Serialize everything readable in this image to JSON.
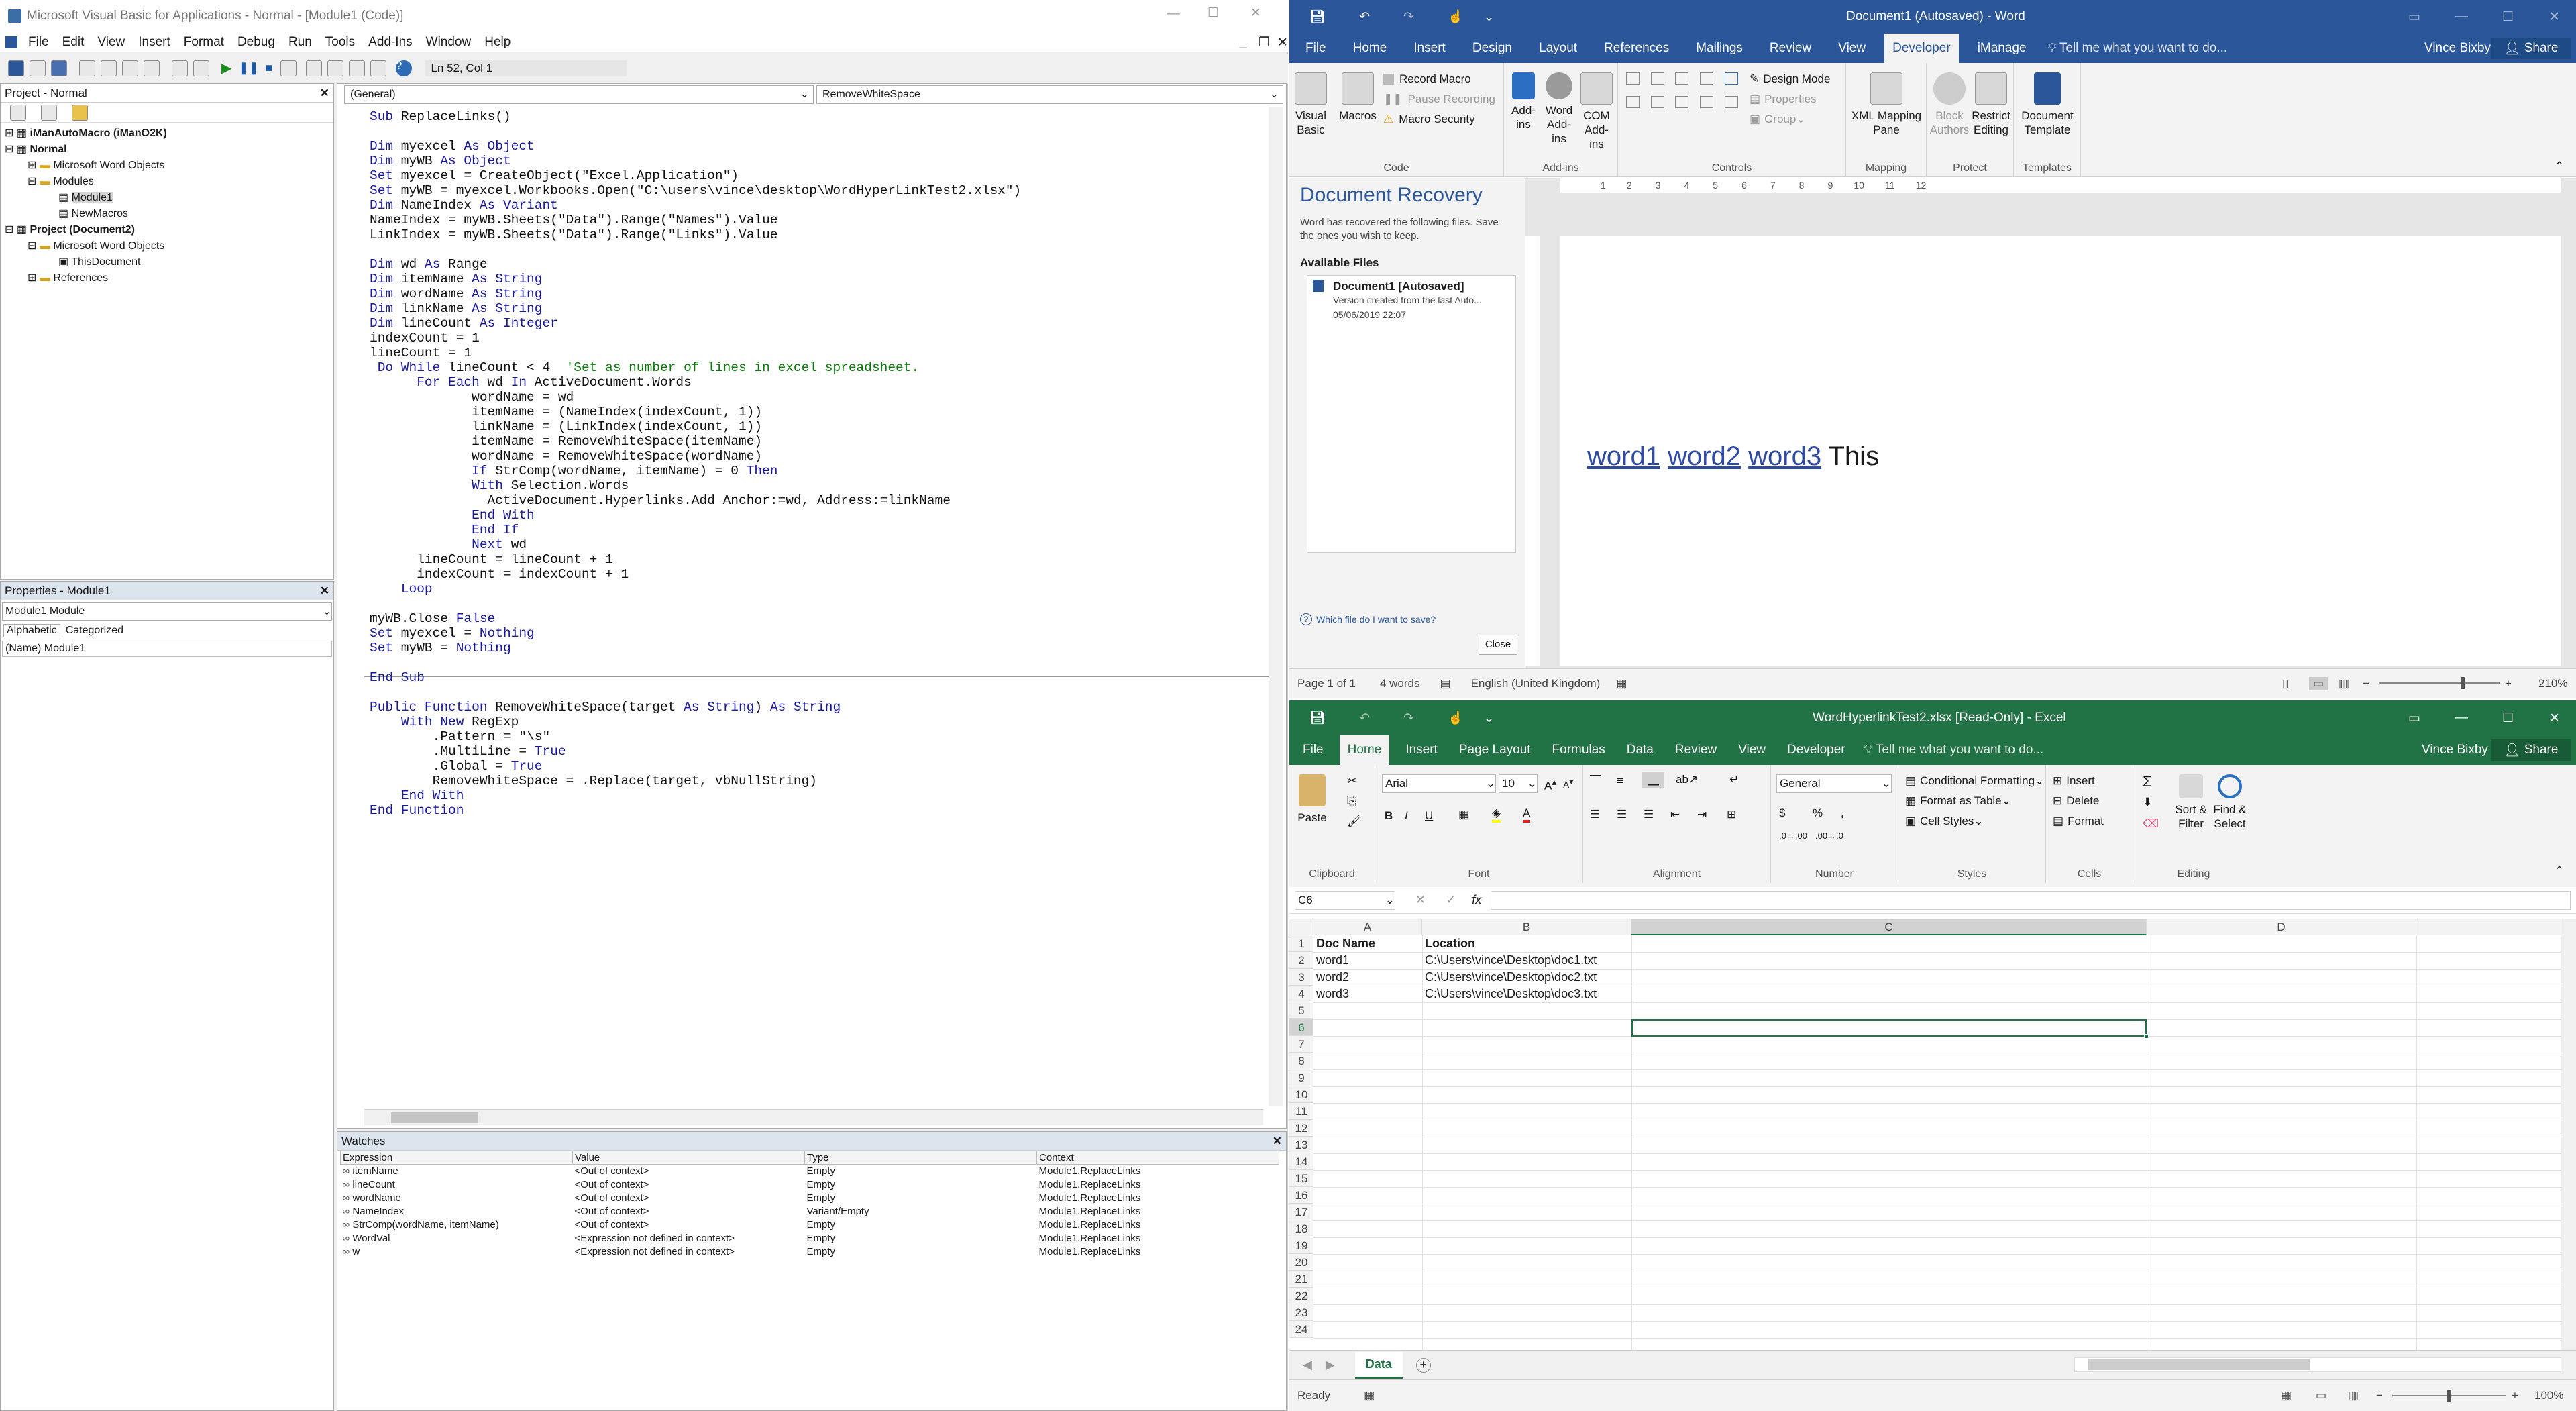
{
  "vbe": {
    "title": "Microsoft Visual Basic for Applications - Normal - [Module1 (Code)]",
    "menu": [
      "File",
      "Edit",
      "View",
      "Insert",
      "Format",
      "Debug",
      "Run",
      "Tools",
      "Add-Ins",
      "Window",
      "Help"
    ],
    "position": "Ln 52, Col 1",
    "project_title": "Project - Normal",
    "tree": [
      "iManAutoMacro (iManO2K)",
      "Normal",
      "Microsoft Word Objects",
      "Modules",
      "Module1",
      "NewMacros",
      "Project (Document2)",
      "Microsoft Word Objects",
      "ThisDocument",
      "References"
    ],
    "props_title": "Properties - Module1",
    "props_object": "Module1 Module",
    "props_tabs": [
      "Alphabetic",
      "Categorized"
    ],
    "props_name_row": "(Name) Module1",
    "code_object": "(General)",
    "code_proc": "RemoveWhiteSpace",
    "watches_title": "Watches",
    "watch_headers": [
      "Expression",
      "Value",
      "Type",
      "Context"
    ],
    "watch_rows": [
      [
        "itemName",
        "<Out of context>",
        "Empty",
        "Module1.ReplaceLinks"
      ],
      [
        "lineCount",
        "<Out of context>",
        "Empty",
        "Module1.ReplaceLinks"
      ],
      [
        "wordName",
        "<Out of context>",
        "Empty",
        "Module1.ReplaceLinks"
      ],
      [
        "NameIndex",
        "<Out of context>",
        "Variant/Empty",
        "Module1.ReplaceLinks"
      ],
      [
        "StrComp(wordName, itemName)",
        "<Out of context>",
        "Empty",
        "Module1.ReplaceLinks"
      ],
      [
        "WordVal",
        "<Expression not defined in context>",
        "Empty",
        "Module1.ReplaceLinks"
      ],
      [
        "w",
        "<Expression not defined in context>",
        "Empty",
        "Module1.ReplaceLinks"
      ]
    ]
  },
  "word": {
    "title": "Document1 (Autosaved) - Word",
    "user": "Vince Bixby",
    "share": "Share",
    "tabs": [
      "File",
      "Home",
      "Insert",
      "Design",
      "Layout",
      "References",
      "Mailings",
      "Review",
      "View",
      "Developer",
      "iManage"
    ],
    "tell_me": "Tell me what you want to do...",
    "ribbon": {
      "visual_basic": "Visual Basic",
      "macros": "Macros",
      "record_macro": "Record Macro",
      "pause_recording": "Pause Recording",
      "macro_security": "Macro Security",
      "code_group": "Code",
      "addins": "Add-ins",
      "word_addins": "Word Add-ins",
      "com_addins": "COM Add-ins",
      "addins_group": "Add-ins",
      "design_mode": "Design Mode",
      "properties": "Properties",
      "group": "Group",
      "controls_group": "Controls",
      "xml_mapping": "XML Mapping Pane",
      "mapping_group": "Mapping",
      "block_authors": "Block Authors",
      "restrict_editing": "Restrict Editing",
      "protect_group": "Protect",
      "doc_template": "Document Template",
      "templates_group": "Templates"
    },
    "recovery": {
      "title": "Document Recovery",
      "desc": "Word has recovered the following files.  Save the ones you wish to keep.",
      "available": "Available Files",
      "file_name": "Document1  [Autosaved]",
      "file_desc": "Version created from the last Auto...",
      "file_date": "05/06/2019 22:07",
      "which": "Which file do I want to save?",
      "close": "Close"
    },
    "doc_words": [
      "word1",
      "word2",
      "word3"
    ],
    "doc_plain": "This",
    "status": {
      "page": "Page 1 of 1",
      "words": "4 words",
      "lang": "English (United Kingdom)",
      "zoom": "210%"
    }
  },
  "excel": {
    "title": "WordHyperlinkTest2.xlsx  [Read-Only] - Excel",
    "user": "Vince Bixby",
    "share": "Share",
    "tabs": [
      "File",
      "Home",
      "Insert",
      "Page Layout",
      "Formulas",
      "Data",
      "Review",
      "View",
      "Developer"
    ],
    "tell_me": "Tell me what you want to do...",
    "ribbon": {
      "paste": "Paste",
      "clipboard": "Clipboard",
      "font_name": "Arial",
      "font_size": "10",
      "font_group": "Font",
      "alignment_group": "Alignment",
      "number_format": "General",
      "number_group": "Number",
      "cond_format": "Conditional Formatting",
      "format_table": "Format as Table",
      "cell_styles": "Cell Styles",
      "styles_group": "Styles",
      "insert": "Insert",
      "delete": "Delete",
      "format": "Format",
      "cells_group": "Cells",
      "sort_filter": "Sort & Filter",
      "find_select": "Find & Select",
      "editing_group": "Editing"
    },
    "name_box": "C6",
    "fx": "fx",
    "columns": [
      "A",
      "B",
      "C",
      "D"
    ],
    "rows": [
      [
        "Doc Name",
        "Location"
      ],
      [
        "word1",
        "C:\\Users\\vince\\Desktop\\doc1.txt"
      ],
      [
        "word2",
        "C:\\Users\\vince\\Desktop\\doc2.txt"
      ],
      [
        "word3",
        "C:\\Users\\vince\\Desktop\\doc3.txt"
      ]
    ],
    "row_count": 24,
    "sheet_tab": "Data",
    "status": "Ready",
    "zoom": "100%"
  }
}
